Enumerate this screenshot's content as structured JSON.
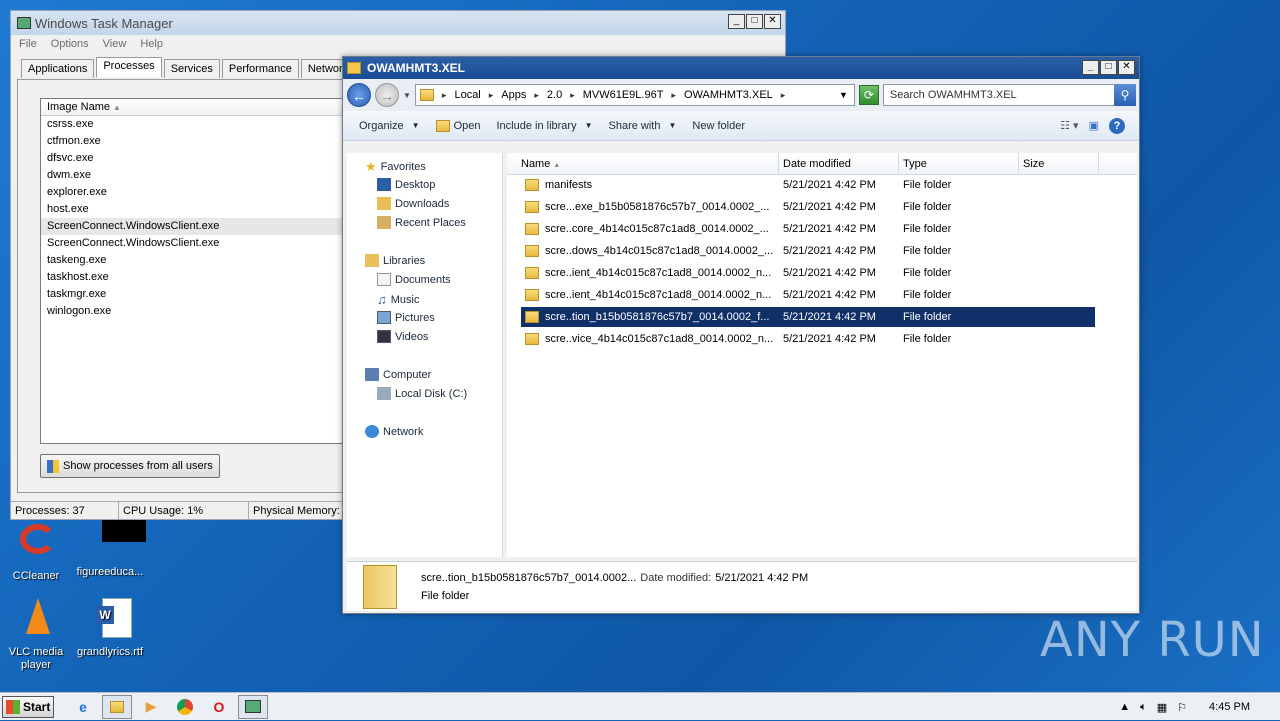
{
  "desktop": {
    "icons": [
      {
        "label": "CCleaner"
      },
      {
        "label": "figureeduca..."
      },
      {
        "label": "VLC media player"
      },
      {
        "label": "grandlyrics.rtf"
      }
    ],
    "watermark": "ANY RUN"
  },
  "task_manager": {
    "title": "Windows Task Manager",
    "menu": [
      "File",
      "Options",
      "View",
      "Help"
    ],
    "tabs": [
      "Applications",
      "Processes",
      "Services",
      "Performance",
      "Networking"
    ],
    "active_tab": "Processes",
    "column_header": "Image Name",
    "processes": [
      "csrss.exe",
      "ctfmon.exe",
      "dfsvc.exe",
      "dwm.exe",
      "explorer.exe",
      "host.exe",
      "ScreenConnect.WindowsClient.exe",
      "ScreenConnect.WindowsClient.exe",
      "taskeng.exe",
      "taskhost.exe",
      "taskmgr.exe",
      "winlogon.exe"
    ],
    "show_all_button": "Show processes from all users",
    "status": {
      "processes": "Processes: 37",
      "cpu": "CPU Usage: 1%",
      "memory": "Physical Memory:"
    }
  },
  "explorer": {
    "title": "OWAMHMT3.XEL",
    "breadcrumb": [
      "Local",
      "Apps",
      "2.0",
      "MVW61E9L.96T",
      "OWAMHMT3.XEL"
    ],
    "search_placeholder": "Search OWAMHMT3.XEL",
    "toolbar": {
      "organize": "Organize",
      "open": "Open",
      "include": "Include in library",
      "share": "Share with",
      "new_folder": "New folder"
    },
    "nav": {
      "favorites": "Favorites",
      "desktop": "Desktop",
      "downloads": "Downloads",
      "recent": "Recent Places",
      "libraries": "Libraries",
      "documents": "Documents",
      "music": "Music",
      "pictures": "Pictures",
      "videos": "Videos",
      "computer": "Computer",
      "local_disk": "Local Disk (C:)",
      "network": "Network"
    },
    "columns": [
      "Name",
      "Date modified",
      "Type",
      "Size"
    ],
    "files": [
      {
        "name": "manifests",
        "date": "5/21/2021 4:42 PM",
        "type": "File folder"
      },
      {
        "name": "scre...exe_b15b0581876c57b7_0014.0002_...",
        "date": "5/21/2021 4:42 PM",
        "type": "File folder"
      },
      {
        "name": "scre..core_4b14c015c87c1ad8_0014.0002_...",
        "date": "5/21/2021 4:42 PM",
        "type": "File folder"
      },
      {
        "name": "scre..dows_4b14c015c87c1ad8_0014.0002_...",
        "date": "5/21/2021 4:42 PM",
        "type": "File folder"
      },
      {
        "name": "scre..ient_4b14c015c87c1ad8_0014.0002_n...",
        "date": "5/21/2021 4:42 PM",
        "type": "File folder"
      },
      {
        "name": "scre..ient_4b14c015c87c1ad8_0014.0002_n...",
        "date": "5/21/2021 4:42 PM",
        "type": "File folder"
      },
      {
        "name": "scre..tion_b15b0581876c57b7_0014.0002_f...",
        "date": "5/21/2021 4:42 PM",
        "type": "File folder"
      },
      {
        "name": "scre..vice_4b14c015c87c1ad8_0014.0002_n...",
        "date": "5/21/2021 4:42 PM",
        "type": "File folder"
      }
    ],
    "selected_index": 6,
    "details": {
      "name": "scre..tion_b15b0581876c57b7_0014.0002...",
      "date_label": "Date modified:",
      "date": "5/21/2021 4:42 PM",
      "type": "File folder"
    }
  },
  "taskbar": {
    "start": "Start",
    "clock": "4:45 PM"
  }
}
